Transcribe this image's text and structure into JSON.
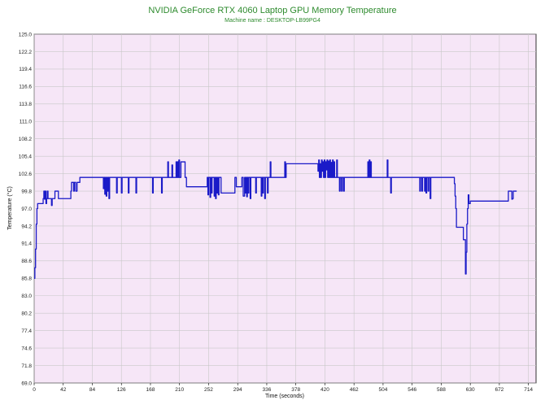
{
  "chart_data": {
    "type": "line",
    "title": "NVIDIA GeForce RTX 4060 Laptop GPU Memory Temperature",
    "subtitle": "Machine name : DESKTOP-LB99PG4",
    "xlabel": "Time (seconds)",
    "ylabel": "Temperature (°C)",
    "xlim": [
      0,
      725
    ],
    "ylim": [
      69.0,
      125.0
    ],
    "grid": true,
    "colors": {
      "background": "#f6e6f7",
      "line": "#1a1ac8",
      "grid": "#c8c8c8",
      "title": "#2e8b2e"
    },
    "x_ticks": [
      "0",
      "42",
      "84",
      "126",
      "168",
      "210",
      "252",
      "294",
      "336",
      "378",
      "420",
      "462",
      "504",
      "546",
      "588",
      "630",
      "672",
      "714"
    ],
    "y_ticks": [
      "125.0",
      "122.2",
      "119.4",
      "116.6",
      "113.8",
      "111.0",
      "108.2",
      "105.4",
      "102.6",
      "99.8",
      "97.0",
      "94.2",
      "91.4",
      "88.6",
      "85.8",
      "83.0",
      "80.2",
      "77.4",
      "74.6",
      "71.8",
      "69.0"
    ],
    "x": [
      0,
      1,
      2,
      3,
      4,
      5,
      6,
      7,
      8,
      12,
      13,
      14,
      15,
      16,
      17,
      18,
      19,
      20,
      24,
      25,
      26,
      29,
      30,
      34,
      35,
      36,
      38,
      42,
      52,
      53,
      54,
      56,
      57,
      58,
      60,
      62,
      64,
      66,
      68,
      70,
      99,
      100,
      101,
      102,
      103,
      104,
      105,
      106,
      107,
      108,
      109,
      110,
      118,
      119,
      120,
      125,
      126,
      127,
      135,
      136,
      137,
      146,
      147,
      148,
      170,
      171,
      172,
      183,
      184,
      185,
      192,
      193,
      194,
      198,
      199,
      200,
      204,
      205,
      206,
      207,
      208,
      209,
      210,
      211,
      212,
      218,
      219,
      220,
      250,
      251,
      252,
      253,
      254,
      255,
      256,
      257,
      258,
      260,
      261,
      262,
      263,
      264,
      265,
      266,
      267,
      268,
      269,
      270,
      290,
      291,
      292,
      300,
      301,
      302,
      304,
      305,
      306,
      307,
      308,
      309,
      310,
      311,
      312,
      313,
      314,
      315,
      320,
      321,
      322,
      328,
      329,
      330,
      331,
      332,
      333,
      334,
      335,
      336,
      337,
      338,
      340,
      341,
      342,
      362,
      363,
      364,
      410,
      411,
      412,
      413,
      414,
      415,
      416,
      417,
      418,
      419,
      420,
      421,
      422,
      423,
      424,
      425,
      426,
      427,
      428,
      429,
      430,
      431,
      432,
      433,
      434,
      435,
      436,
      437,
      438,
      439,
      440,
      441,
      442,
      443,
      444,
      445,
      446,
      447,
      448,
      449,
      482,
      483,
      484,
      485,
      486,
      487,
      510,
      511,
      512,
      514,
      515,
      516,
      556,
      557,
      558,
      559,
      560,
      561,
      562,
      563,
      564,
      565,
      566,
      567,
      568,
      569,
      570,
      571,
      572,
      573,
      574,
      606,
      607,
      608,
      609,
      610,
      620,
      621,
      622,
      623,
      624,
      625,
      626,
      627,
      628,
      629,
      630,
      685,
      690,
      691,
      692,
      693,
      694,
      695,
      696,
      697,
      698,
      699,
      700,
      701,
      702,
      703,
      704,
      705,
      706,
      707,
      708,
      710,
      712,
      714,
      716,
      720,
      725
    ],
    "values": [
      85.8,
      87.5,
      90.5,
      94.5,
      97.0,
      97.8,
      97.8,
      97.8,
      97.8,
      97.8,
      98.6,
      99.8,
      98.5,
      99.8,
      97.8,
      98.6,
      99.8,
      98.6,
      98.6,
      97.5,
      98.6,
      98.6,
      99.8,
      99.8,
      98.6,
      98.6,
      98.6,
      98.6,
      98.6,
      99.8,
      101.2,
      101.2,
      99.8,
      101.2,
      99.8,
      101.2,
      101.2,
      102.0,
      102.0,
      102.0,
      102.0,
      100.2,
      102.0,
      99.3,
      102.0,
      99.0,
      102.0,
      99.8,
      102.0,
      98.6,
      102.0,
      102.0,
      102.0,
      99.5,
      102.0,
      102.0,
      99.5,
      102.0,
      102.0,
      99.5,
      102.0,
      102.0,
      99.5,
      102.0,
      102.0,
      99.5,
      102.0,
      102.0,
      99.5,
      102.0,
      102.0,
      104.5,
      102.0,
      102.0,
      104.0,
      102.0,
      102.0,
      104.5,
      102.0,
      104.5,
      102.0,
      104.8,
      102.0,
      102.0,
      104.5,
      102.0,
      102.0,
      100.5,
      102.0,
      99.2,
      102.0,
      102.0,
      98.8,
      102.0,
      99.5,
      102.0,
      102.0,
      99.0,
      102.0,
      98.6,
      102.0,
      99.5,
      102.0,
      99.2,
      102.0,
      102.0,
      102.0,
      99.5,
      102.0,
      102.0,
      100.5,
      102.0,
      102.0,
      99.0,
      102.0,
      99.5,
      102.0,
      98.9,
      102.0,
      99.5,
      102.0,
      102.0,
      98.6,
      102.0,
      102.0,
      102.0,
      99.5,
      102.0,
      102.0,
      99.0,
      102.0,
      99.5,
      102.0,
      102.0,
      98.6,
      102.0,
      102.0,
      102.0,
      99.5,
      102.0,
      102.0,
      104.5,
      102.0,
      104.5,
      102.0,
      104.2,
      103.0,
      104.8,
      102.0,
      104.2,
      102.0,
      104.8,
      103.0,
      104.5,
      102.0,
      104.8,
      102.0,
      104.5,
      103.2,
      104.8,
      102.0,
      104.6,
      102.0,
      104.8,
      102.0,
      104.4,
      102.0,
      104.8,
      102.0,
      104.5,
      102.0,
      102.0,
      102.0,
      104.8,
      102.0,
      102.0,
      102.0,
      99.8,
      102.0,
      102.0,
      99.8,
      102.0,
      102.0,
      99.8,
      102.0,
      102.0,
      104.5,
      102.0,
      104.8,
      102.0,
      104.5,
      102.0,
      104.8,
      102.0,
      102.0,
      102.0,
      99.5,
      102.0,
      102.0,
      99.8,
      102.0,
      102.0,
      99.8,
      102.0,
      102.0,
      102.0,
      99.8,
      102.0,
      99.5,
      102.0,
      102.0,
      99.8,
      102.0,
      102.0,
      98.6,
      102.0,
      102.0,
      102.0,
      101.0,
      99.0,
      97.0,
      94.0,
      92.0,
      92.0,
      92.0,
      86.5,
      90.0,
      94.5,
      97.0,
      99.2,
      97.8,
      97.8,
      98.2,
      99.8,
      98.5,
      98.6,
      99.8,
      99.8,
      99.8,
      99.8,
      99.8
    ]
  }
}
